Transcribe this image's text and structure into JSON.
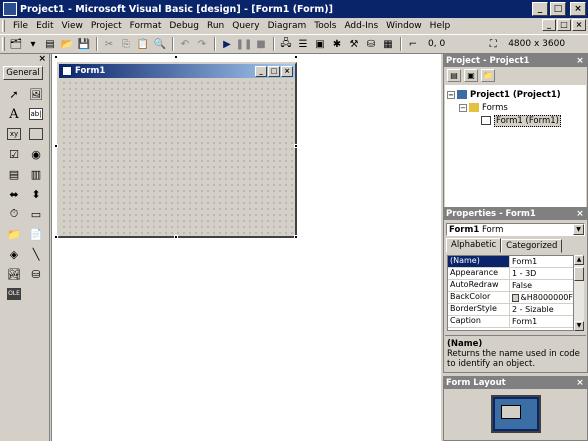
{
  "app": {
    "title": "Project1 - Microsoft Visual Basic [design] - [Form1 (Form)]",
    "caption_buttons": [
      "_",
      "□",
      "×"
    ]
  },
  "menu": [
    "File",
    "Edit",
    "View",
    "Project",
    "Format",
    "Debug",
    "Run",
    "Query",
    "Diagram",
    "Tools",
    "Add-Ins",
    "Window",
    "Help"
  ],
  "toolbar": {
    "position_readout": "0, 0",
    "size_readout": "4800 x 3600"
  },
  "toolbox": {
    "close": "×",
    "tab_label": "General",
    "tools": [
      "pointer-tool",
      "picturebox-tool",
      "label-tool",
      "textbox-tool",
      "frame-tool",
      "commandbutton-tool",
      "checkbox-tool",
      "optionbutton-tool",
      "combobox-tool",
      "listbox-tool",
      "hscrollbar-tool",
      "vscrollbar-tool",
      "timer-tool",
      "drivelistbox-tool",
      "dirlistbox-tool",
      "filelistbox-tool",
      "shape-tool",
      "line-tool",
      "image-tool",
      "data-tool",
      "ole-tool"
    ]
  },
  "form": {
    "title": "Form1"
  },
  "project_panel": {
    "title": "Project - Project1",
    "tree": {
      "root": "Project1 (Project1)",
      "folder": "Forms",
      "item": "Form1 (Form1)"
    }
  },
  "properties_panel": {
    "title": "Properties - Form1",
    "object_name": "Form1",
    "object_type": "Form",
    "tabs": [
      "Alphabetic",
      "Categorized"
    ],
    "rows": [
      {
        "name": "(Name)",
        "value": "Form1"
      },
      {
        "name": "Appearance",
        "value": "1 - 3D"
      },
      {
        "name": "AutoRedraw",
        "value": "False"
      },
      {
        "name": "BackColor",
        "value": "&H8000000F"
      },
      {
        "name": "BorderStyle",
        "value": "2 - Sizable"
      },
      {
        "name": "Caption",
        "value": "Form1"
      }
    ],
    "description_name": "(Name)",
    "description_text": "Returns the name used in code to identify an object."
  },
  "form_layout_panel": {
    "title": "Form Layout"
  },
  "colors": {
    "title_active": "#0a246a",
    "face": "#d4d0c8",
    "panel_title_inactive": "#808080"
  }
}
